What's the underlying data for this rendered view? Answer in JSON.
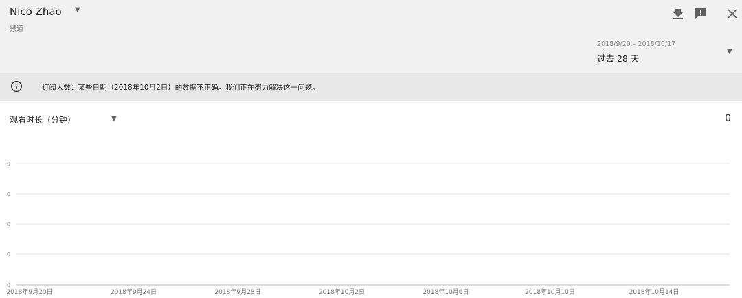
{
  "header": {
    "channel_name": "Nico Zhao",
    "channel_sub": "频道",
    "download_icon": "download-icon",
    "feedback_icon": "feedback-icon",
    "close_icon": "close-icon",
    "date_range": "2018/9/20 – 2018/10/17",
    "date_label": "过去 28 天"
  },
  "notice": {
    "icon": "info-icon",
    "text": "订阅人数：某些日期（2018年10月2日）的数据不正确。我们正在努力解决这一问题。"
  },
  "metric": {
    "label": "观看时长（分钟）",
    "total": "0"
  },
  "chart_data": {
    "type": "line",
    "title": "",
    "xlabel": "",
    "ylabel": "",
    "y_ticks": [
      "0",
      "0",
      "0",
      "0",
      "0"
    ],
    "x_tick_labels": [
      "2018年9月20日",
      "2018年9月24日",
      "2018年9月28日",
      "2018年10月2日",
      "2018年10月6日",
      "2018年10月10日",
      "2018年10月14日"
    ],
    "x": [
      "2018-09-20",
      "2018-09-21",
      "2018-09-22",
      "2018-09-23",
      "2018-09-24",
      "2018-09-25",
      "2018-09-26",
      "2018-09-27",
      "2018-09-28",
      "2018-09-29",
      "2018-09-30",
      "2018-10-01",
      "2018-10-02",
      "2018-10-03",
      "2018-10-04",
      "2018-10-05",
      "2018-10-06",
      "2018-10-07",
      "2018-10-08",
      "2018-10-09",
      "2018-10-10",
      "2018-10-11",
      "2018-10-12",
      "2018-10-13",
      "2018-10-14",
      "2018-10-15",
      "2018-10-16",
      "2018-10-17"
    ],
    "series": [
      {
        "values": [
          0,
          0,
          0,
          0,
          0,
          0,
          0,
          0,
          0,
          0,
          0,
          0,
          0,
          0,
          0,
          0,
          0,
          0,
          0,
          0,
          0,
          0,
          0,
          0,
          0,
          0,
          0,
          0
        ],
        "color": "#4285f4"
      }
    ],
    "ylim": [
      0,
      0
    ],
    "grid": true
  }
}
